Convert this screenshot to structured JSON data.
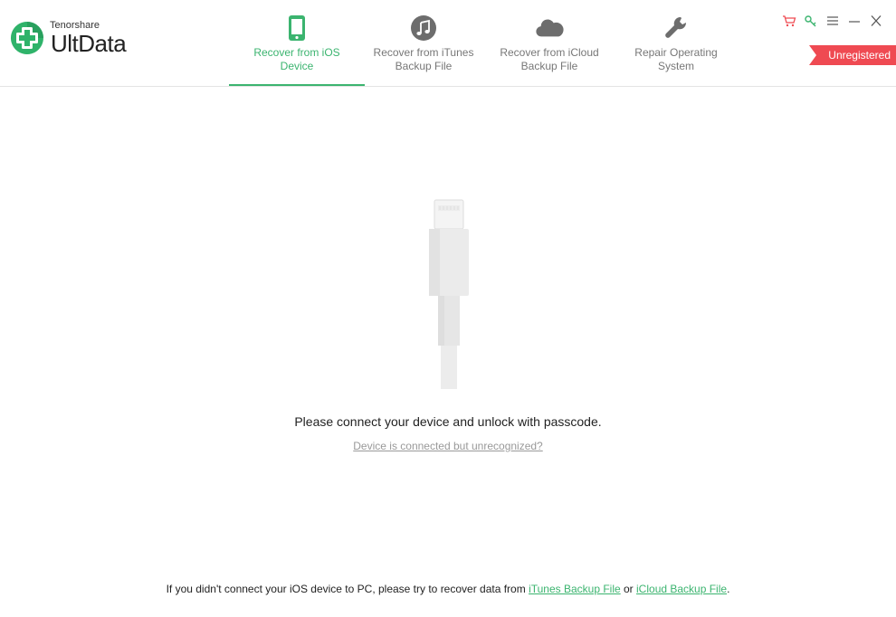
{
  "app": {
    "brand_small": "Tenorshare",
    "brand_large": "UltData",
    "accent_color": "#3bb46f"
  },
  "tabs": [
    {
      "label": "Recover from iOS\nDevice",
      "icon": "phone-icon",
      "active": true
    },
    {
      "label": "Recover from iTunes\nBackup File",
      "icon": "music-note-icon",
      "active": false
    },
    {
      "label": "Recover from iCloud\nBackup File",
      "icon": "cloud-icon",
      "active": false
    },
    {
      "label": "Repair Operating\nSystem",
      "icon": "wrench-icon",
      "active": false
    }
  ],
  "window_controls": {
    "cart": "cart-icon",
    "key": "key-icon",
    "menu": "menu-icon",
    "minimize": "minimize-icon",
    "close": "close-icon"
  },
  "badge": {
    "text": "Unregistered",
    "color": "#ef4a52"
  },
  "main": {
    "connect_message": "Please connect your device and unlock with passcode.",
    "unrecognized_link": "Device is connected but unrecognized?"
  },
  "footer": {
    "text_before": "If you didn't connect your iOS device to PC, please try to recover data from ",
    "link_itunes": "iTunes Backup File",
    "text_or": " or ",
    "link_icloud": "iCloud Backup File",
    "text_after": "."
  }
}
